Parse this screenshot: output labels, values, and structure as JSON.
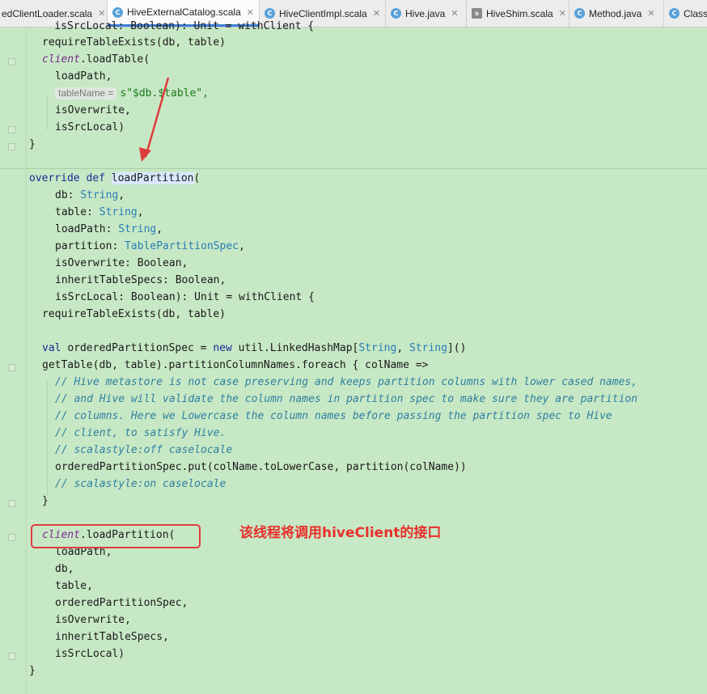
{
  "tabs": [
    {
      "label": "edClientLoader.scala",
      "icon": "scala-file-icon",
      "active": false
    },
    {
      "label": "HiveExternalCatalog.scala",
      "icon": "scala-class-icon",
      "active": true
    },
    {
      "label": "HiveClientImpl.scala",
      "icon": "scala-class-icon",
      "active": false
    },
    {
      "label": "Hive.java",
      "icon": "java-class-icon",
      "active": false
    },
    {
      "label": "HiveShim.scala",
      "icon": "scala-file-icon",
      "active": false
    },
    {
      "label": "Method.java",
      "icon": "java-class-icon",
      "active": false
    },
    {
      "label": "Class",
      "icon": "java-class-icon",
      "active": false
    }
  ],
  "code": {
    "l0": "    isSrcLocal: Boolean): Unit = withClient {",
    "l1": "requireTableExists(db, table)",
    "l2a": "client",
    "l2b": ".loadTable(",
    "l3": "loadPath,",
    "l4hint": "tableName =",
    "l4": "s\"$db.$table\",",
    "l5": "isOverwrite,",
    "l6": "isSrcLocal)",
    "l7": "}",
    "l9kw": "override def ",
    "l9fn": "loadPartition",
    "l9end": "(",
    "l10a": "db: ",
    "l10t": "String",
    "l10e": ",",
    "l11a": "table: ",
    "l11t": "String",
    "l11e": ",",
    "l12a": "loadPath: ",
    "l12t": "String",
    "l12e": ",",
    "l13a": "partition: ",
    "l13t": "TablePartitionSpec",
    "l13e": ",",
    "l14": "isOverwrite: Boolean,",
    "l15": "inheritTableSpecs: Boolean,",
    "l16": "isSrcLocal: Boolean): Unit = withClient {",
    "l17": "requireTableExists(db, table)",
    "l19kw": "val ",
    "l19a": "orderedPartitionSpec = ",
    "l19new": "new ",
    "l19b": "util.LinkedHashMap[",
    "l19t1": "String",
    "l19c": ", ",
    "l19t2": "String",
    "l19d": "]()",
    "l20": "getTable(db, table).partitionColumnNames.foreach { colName =>",
    "l21": "// Hive metastore is not case preserving and keeps partition columns with lower cased names,",
    "l22": "// and Hive will validate the column names in partition spec to make sure they are partition",
    "l23": "// columns. Here we Lowercase the column names before passing the partition spec to Hive",
    "l24": "// client, to satisfy Hive.",
    "l25": "// scalastyle:off caselocale",
    "l26": "orderedPartitionSpec.put(colName.toLowerCase, partition(colName))",
    "l27": "// scalastyle:on caselocale",
    "l28": "}",
    "l30a": "client",
    "l30b": ".loadPartition(",
    "l31": "loadPath,",
    "l32": "db,",
    "l33": "table,",
    "l34": "orderedPartitionSpec,",
    "l35": "isOverwrite,",
    "l36": "inheritTableSpecs,",
    "l37": "isSrcLocal)",
    "l38": "}"
  },
  "annotation": {
    "note": "该线程将调用hiveClient的接口",
    "color": "#e8302c"
  }
}
